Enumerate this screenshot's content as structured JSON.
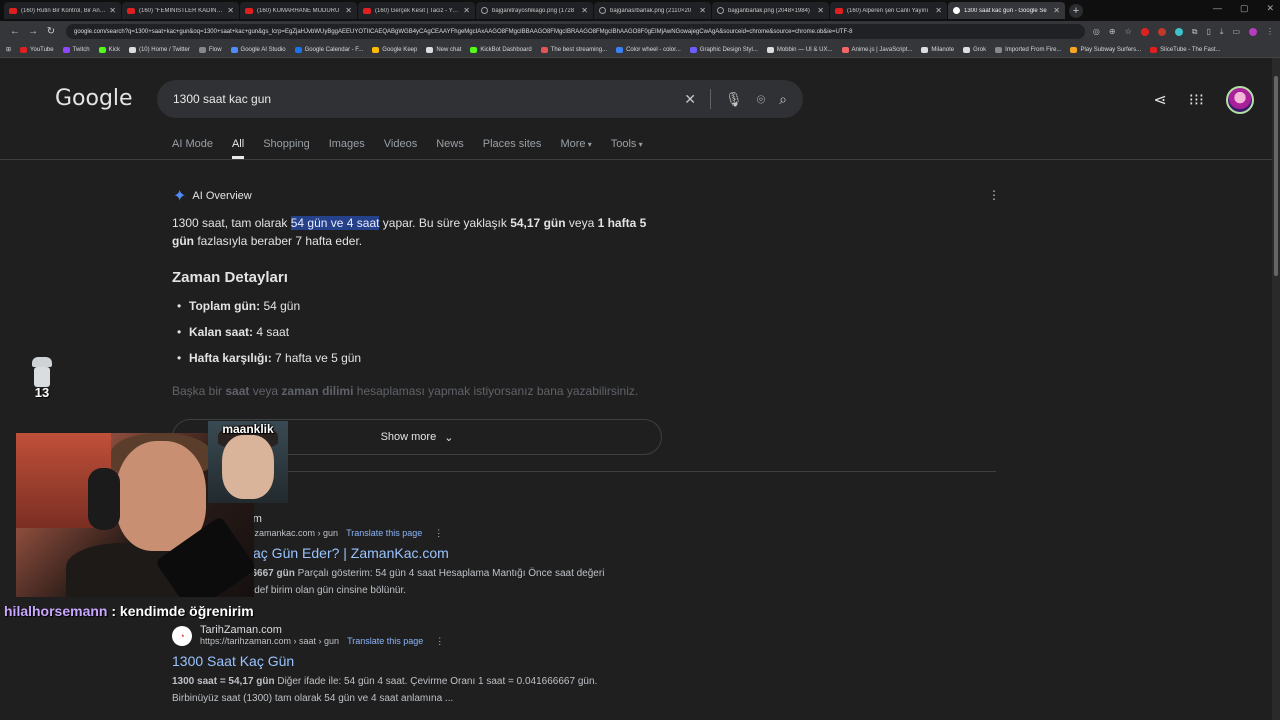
{
  "browser": {
    "tabs": [
      {
        "title": "(160) Rutin Bir Kontrol, Bir Anda",
        "favicon": "youtube-icon",
        "active": false
      },
      {
        "title": "(160) \"FEMİNİSTLER KADINLAR",
        "favicon": "youtube-icon",
        "active": false
      },
      {
        "title": "(160) KUMARHANE MÜDÜRÜ",
        "favicon": "youtube-icon",
        "active": false
      },
      {
        "title": "(160) Gerçek Kesit | Taciz - YouT",
        "favicon": "youtube-icon",
        "active": false
      },
      {
        "title": "bajganitrayoshikago.png (1728",
        "favicon": "globe-icon",
        "active": false
      },
      {
        "title": "bajganasrbarlak.png (2110×20",
        "favicon": "globe-icon",
        "active": false
      },
      {
        "title": "bajganbarlak.png (2048×1984)",
        "favicon": "globe-icon",
        "active": false
      },
      {
        "title": "(160) Alperen şen Canlı Yayını",
        "favicon": "youtube-icon",
        "active": false
      },
      {
        "title": "1300 saat kac gun - Google Se",
        "favicon": "google-icon",
        "active": true
      }
    ],
    "url": "google.com/search?q=1300+saat+kac+gun&oq=1300+saat+kac+gun&gs_lcrp=EgZjaHJvbWUyBggAEEUYOTIICAEQABgWGB4yCAgCEAAYFhgeMgcIAxAAGO8FMgcIBBAAGO8FMgcIBRAAGO8FMgcIBhAAGO8F0gEIMjAwNGowajegCwAgA&sourceid=chrome&source=chrome.ob&ie=UTF-8",
    "bookmarks": [
      {
        "label": "YouTube",
        "color": "#e02020"
      },
      {
        "label": "Twitch",
        "color": "#9146ff"
      },
      {
        "label": "Kick",
        "color": "#53fc18"
      },
      {
        "label": "(10) Home / Twitter",
        "color": "#dddddd"
      },
      {
        "label": "Flow",
        "color": "#888888"
      },
      {
        "label": "Google AI Studio",
        "color": "#4f8bf9"
      },
      {
        "label": "Google Calendar - F...",
        "color": "#1a73e8"
      },
      {
        "label": "Google Keep",
        "color": "#fbbc04"
      },
      {
        "label": "New chat",
        "color": "#dddddd"
      },
      {
        "label": "KickBot Dashboard",
        "color": "#53fc18"
      },
      {
        "label": "The best streaming...",
        "color": "#e25555"
      },
      {
        "label": "Color wheel - color...",
        "color": "#3b82f6"
      },
      {
        "label": "Graphic Design Styl...",
        "color": "#6d5dfc"
      },
      {
        "label": "Mobbin — UI & UX...",
        "color": "#dddddd"
      },
      {
        "label": "Anime.js | JavaScript...",
        "color": "#f56565"
      },
      {
        "label": "Milanote",
        "color": "#dddddd"
      },
      {
        "label": "Grok",
        "color": "#dddddd"
      },
      {
        "label": "Imported From Fire...",
        "color": "#888888"
      },
      {
        "label": "Play Subway Surfers...",
        "color": "#f6a623"
      },
      {
        "label": "SliceTube - The Fast...",
        "color": "#e02020"
      }
    ]
  },
  "google": {
    "logo": "Google",
    "query": "1300 saat kac gun",
    "tabs": [
      {
        "label": "AI Mode",
        "active": false
      },
      {
        "label": "All",
        "active": true
      },
      {
        "label": "Shopping",
        "active": false
      },
      {
        "label": "Images",
        "active": false
      },
      {
        "label": "Videos",
        "active": false
      },
      {
        "label": "News",
        "active": false
      },
      {
        "label": "Places sites",
        "active": false
      },
      {
        "label": "More",
        "active": false
      },
      {
        "label": "Tools",
        "active": false
      }
    ]
  },
  "ai_overview": {
    "label": "AI Overview",
    "p1_before": "1300 saat, tam olarak ",
    "p1_highlight": "54 gün ve 4 saat",
    "p1_mid": " yapar. Bu süre yaklaşık ",
    "p1_bold1": "54,17 gün",
    "p1_mid2": " veya ",
    "p1_bold2": "1 hafta 5 gün",
    "p1_after": " fazlasıyla beraber 7 hafta eder.",
    "heading": "Zaman Detayları",
    "items": [
      {
        "term": "Toplam gün:",
        "value": " 54 gün"
      },
      {
        "term": "Kalan saat:",
        "value": " 4 saat"
      },
      {
        "term": "Hafta karşılığı:",
        "value": " 7 hafta ve 5 gün"
      }
    ],
    "fade_a": "Başka bir ",
    "fade_b": "saat",
    "fade_c": " veya ",
    "fade_d": "zaman dilimi",
    "fade_e": " hesaplaması yapmak istiyorsanız bana yazabilirsiniz.",
    "show_more": "Show more"
  },
  "results": [
    {
      "site": "...com",
      "crumb": "...aat.zamankac.com › gun",
      "translate": "Translate this page",
      "title": "...Kaç Gün Eder? | ZamanKac.com",
      "snippet_bold": "...666667 gün",
      "snippet_rest": " Parçalı gösterim: 54 gün 4 saat Hesaplama Mantığı Önce saat değeri",
      "snippet_line2": "... hedef birim olan gün cinsine bölünür."
    },
    {
      "site": "TarihZaman.com",
      "crumb": "https://tarihzaman.com › saat › gun",
      "translate": "Translate this page",
      "title": "1300 Saat Kaç Gün",
      "snippet_bold": "1300 saat = 54,17 gün",
      "snippet_rest": " Diğer ifade ile: 54 gün 4 saat. Çevirme Oranı 1 saat = 0.041666667 gün.",
      "snippet_line2": "Birbinüyüz saat (1300) tam olarak 54 gün ve 4 saat anlamına ..."
    }
  ],
  "stream": {
    "second_cam_label": "maanklik",
    "badge_number": "13",
    "chat_user": "hilalhorsemann",
    "chat_message": " : kendimde öğrenirim"
  }
}
